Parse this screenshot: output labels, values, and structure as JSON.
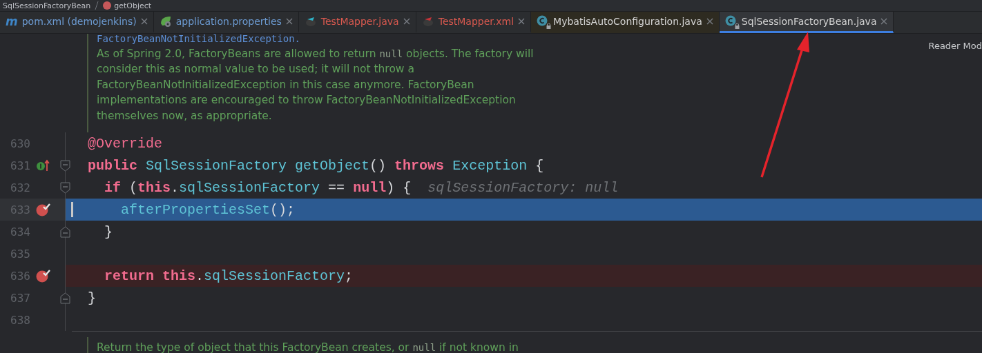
{
  "breadcrumb": [
    {
      "label": "SqlSessionFactoryBean",
      "kind": "class"
    },
    {
      "label": "getObject",
      "kind": "method"
    }
  ],
  "tabs": [
    {
      "label": "pom.xml (demojenkins)",
      "kind": "maven",
      "icon_text": "m",
      "modified": true,
      "has_errors": false,
      "external": false,
      "locked": false,
      "selected": false
    },
    {
      "label": "application.properties",
      "kind": "spring",
      "modified": true,
      "has_errors": false,
      "external": false,
      "locked": false,
      "selected": false
    },
    {
      "label": "TestMapper.java",
      "kind": "mapper",
      "modified": false,
      "has_errors": true,
      "external": false,
      "locked": false,
      "selected": false
    },
    {
      "label": "TestMapper.xml",
      "kind": "mapper-xml",
      "modified": false,
      "has_errors": true,
      "external": false,
      "locked": false,
      "selected": false
    },
    {
      "label": "MybatisAutoConfiguration.java",
      "kind": "class",
      "modified": false,
      "has_errors": false,
      "external": true,
      "locked": true,
      "selected": false
    },
    {
      "label": "SqlSessionFactoryBean.java",
      "kind": "class",
      "modified": false,
      "has_errors": false,
      "external": false,
      "locked": true,
      "selected": true
    }
  ],
  "reader_mode": "Reader Mod",
  "doc_top": {
    "link": "FactoryBeanNotInitializedException.",
    "paragraph": [
      {
        "text": "As of Spring 2.0, FactoryBeans are allowed to return ",
        "code": false
      },
      {
        "text": "null",
        "code": true
      },
      {
        "text": " objects. The factory will consider this as normal value to be used; it will not throw a FactoryBeanNotInitializedException in this case anymore. FactoryBean implementations are encouraged to throw FactoryBeanNotInitializedException themselves now, as appropriate.",
        "code": false
      }
    ]
  },
  "lines": [
    {
      "number": "630",
      "breakpoint": false,
      "implements": false,
      "fold_start": false,
      "fold_end": false,
      "execution_point": false,
      "tokens": [
        {
          "kind": "annotation",
          "text": "@Override"
        }
      ]
    },
    {
      "number": "631",
      "breakpoint": false,
      "implements": true,
      "fold_start": true,
      "fold_end": false,
      "execution_point": false,
      "tokens": [
        {
          "kind": "keyword",
          "text": "public "
        },
        {
          "kind": "type",
          "text": "SqlSessionFactory "
        },
        {
          "kind": "method",
          "text": "getObject"
        },
        {
          "kind": "plain",
          "text": "() "
        },
        {
          "kind": "keyword",
          "text": "throws "
        },
        {
          "kind": "type",
          "text": "Exception"
        },
        {
          "kind": "plain",
          "text": " {"
        }
      ]
    },
    {
      "number": "632",
      "breakpoint": false,
      "implements": false,
      "fold_start": true,
      "fold_end": false,
      "execution_point": false,
      "tokens": [
        {
          "kind": "keyword",
          "text": "  if"
        },
        {
          "kind": "plain",
          "text": " ("
        },
        {
          "kind": "keyword",
          "text": "this"
        },
        {
          "kind": "plain",
          "text": "."
        },
        {
          "kind": "field",
          "text": "sqlSessionFactory"
        },
        {
          "kind": "plain",
          "text": " == "
        },
        {
          "kind": "keyword",
          "text": "null"
        },
        {
          "kind": "plain",
          "text": ") {"
        },
        {
          "kind": "hint",
          "text": "sqlSessionFactory: null"
        }
      ]
    },
    {
      "number": "633",
      "breakpoint": true,
      "implements": false,
      "fold_start": false,
      "fold_end": false,
      "execution_point": true,
      "tokens": [
        {
          "kind": "call",
          "text": "    afterPropertiesSet"
        },
        {
          "kind": "plain",
          "text": "();"
        }
      ]
    },
    {
      "number": "634",
      "breakpoint": false,
      "implements": false,
      "fold_start": false,
      "fold_end": true,
      "execution_point": false,
      "tokens": [
        {
          "kind": "plain",
          "text": "  }"
        }
      ]
    },
    {
      "number": "635",
      "breakpoint": false,
      "implements": false,
      "fold_start": false,
      "fold_end": false,
      "execution_point": false
    },
    {
      "number": "636",
      "breakpoint": true,
      "implements": false,
      "fold_start": false,
      "fold_end": false,
      "execution_point": false,
      "tokens": [
        {
          "kind": "keyword",
          "text": "  return "
        },
        {
          "kind": "keyword",
          "text": "this"
        },
        {
          "kind": "plain",
          "text": "."
        },
        {
          "kind": "field",
          "text": "sqlSessionFactory"
        },
        {
          "kind": "plain",
          "text": ";"
        }
      ]
    },
    {
      "number": "637",
      "breakpoint": false,
      "implements": false,
      "fold_start": false,
      "fold_end": true,
      "execution_point": false,
      "tokens": [
        {
          "kind": "plain",
          "text": "}"
        }
      ]
    },
    {
      "number": "638",
      "breakpoint": false,
      "implements": false,
      "fold_start": false,
      "fold_end": false,
      "execution_point": false
    }
  ],
  "doc_bottom": {
    "paragraph": [
      {
        "text": "Return the type of object that this FactoryBean creates, or ",
        "code": false
      },
      {
        "text": "null",
        "code": true
      },
      {
        "text": " if not known in",
        "code": false
      }
    ]
  }
}
